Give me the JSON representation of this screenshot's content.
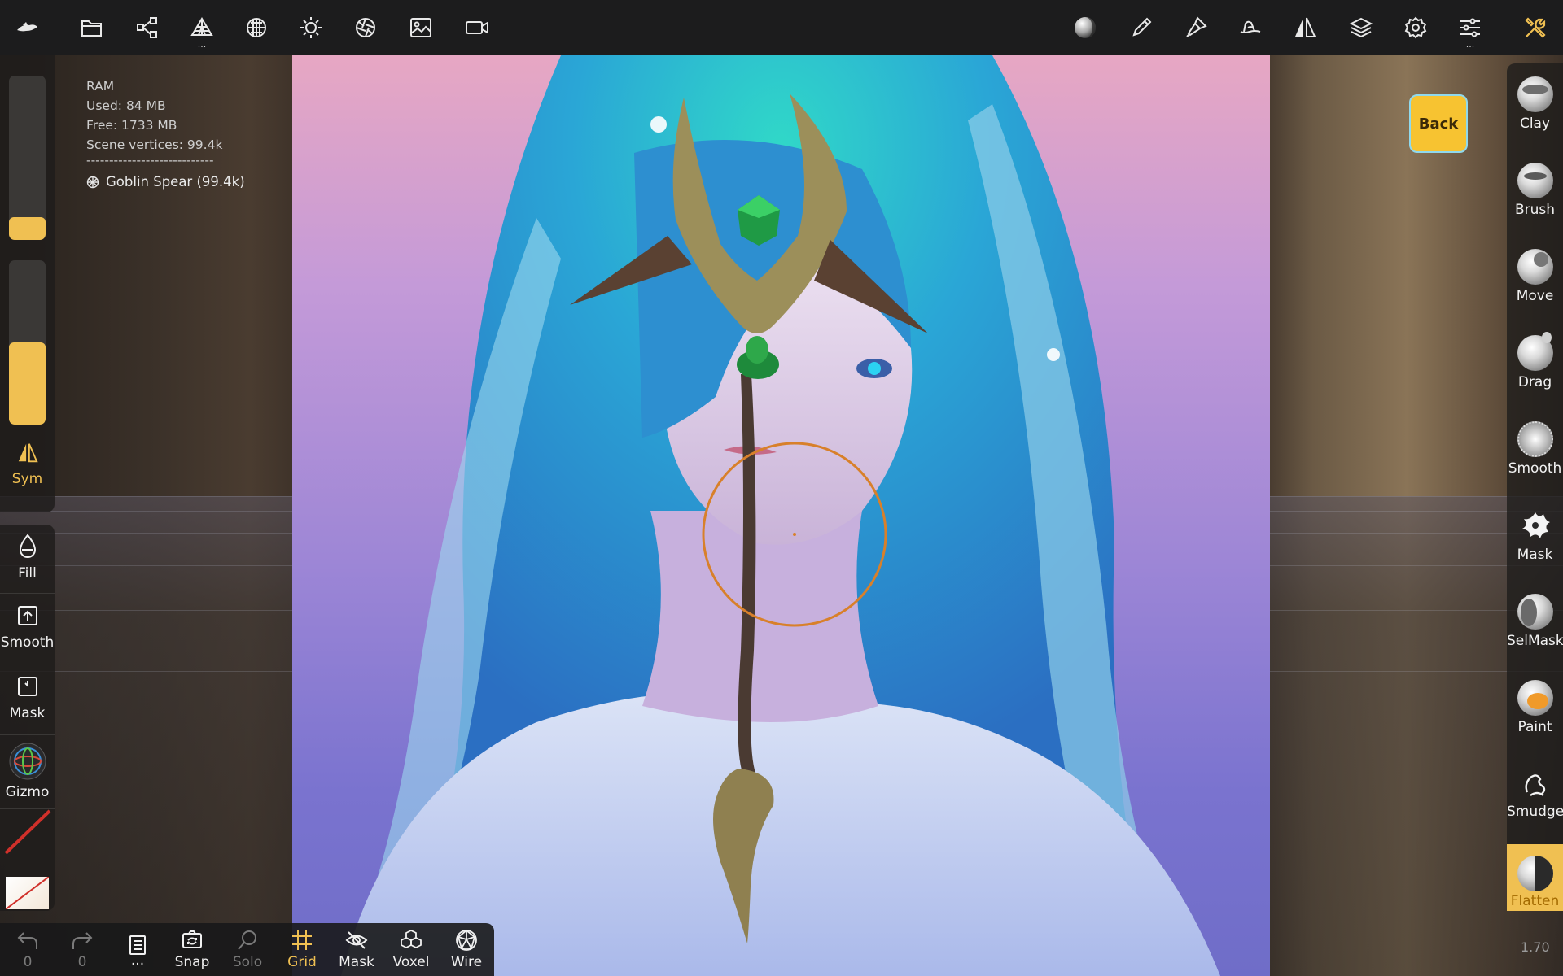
{
  "topbar": {
    "left_icons": [
      {
        "name": "app-logo-icon"
      },
      {
        "name": "files-icon"
      },
      {
        "name": "scene-icon"
      },
      {
        "name": "topology-icon"
      },
      {
        "name": "material-icon"
      },
      {
        "name": "light-icon"
      },
      {
        "name": "camera-lens-icon"
      },
      {
        "name": "background-image-icon"
      },
      {
        "name": "video-icon"
      }
    ],
    "right_icons": [
      {
        "name": "matcap-icon"
      },
      {
        "name": "stroke-icon"
      },
      {
        "name": "painting-icon"
      },
      {
        "name": "tool-settings-icon"
      },
      {
        "name": "symmetry-icon"
      },
      {
        "name": "layers-icon"
      },
      {
        "name": "settings-icon"
      },
      {
        "name": "interface-icon"
      },
      {
        "name": "tools-icon"
      }
    ],
    "more_dots": "..."
  },
  "info": {
    "ram_label": "RAM",
    "used": "Used: 84 MB",
    "free": "Free: 1733 MB",
    "vertices": "Scene vertices: 99.4k",
    "separator": "----------------------------",
    "mesh_name": "Goblin Spear (99.4k)"
  },
  "left_panel": {
    "radius_slider": {
      "value": 0.14
    },
    "intensity_slider": {
      "value": 0.5
    },
    "sym_label": "Sym",
    "tools": [
      {
        "label": "Fill",
        "icon": "drop-icon"
      },
      {
        "label": "Smooth",
        "icon": "smooth-upload-icon"
      },
      {
        "label": "Mask",
        "icon": "mask-square-icon"
      },
      {
        "label": "Gizmo",
        "icon": "gizmo-icon"
      }
    ]
  },
  "right_panel": {
    "tools": [
      {
        "label": "Clay"
      },
      {
        "label": "Brush"
      },
      {
        "label": "Move"
      },
      {
        "label": "Drag"
      },
      {
        "label": "Smooth"
      },
      {
        "label": "Mask"
      },
      {
        "label": "SelMask"
      },
      {
        "label": "Paint"
      },
      {
        "label": "Smudge"
      },
      {
        "label": "Flatten"
      }
    ],
    "active_tool": "Flatten"
  },
  "back_button": {
    "label": "Back"
  },
  "bottom_bar": {
    "undo_count": "0",
    "redo_count": "0",
    "more": "...",
    "items": [
      {
        "label": "Snap"
      },
      {
        "label": "Solo"
      },
      {
        "label": "Grid"
      },
      {
        "label": "Mask"
      },
      {
        "label": "Voxel"
      },
      {
        "label": "Wire"
      }
    ]
  },
  "zoom": "1.70",
  "colors": {
    "accent": "#f0c052",
    "topbar_bg": "#1c1c1d",
    "active_tool_bg": "#f0c052",
    "brush_ring": "#d8802a"
  }
}
